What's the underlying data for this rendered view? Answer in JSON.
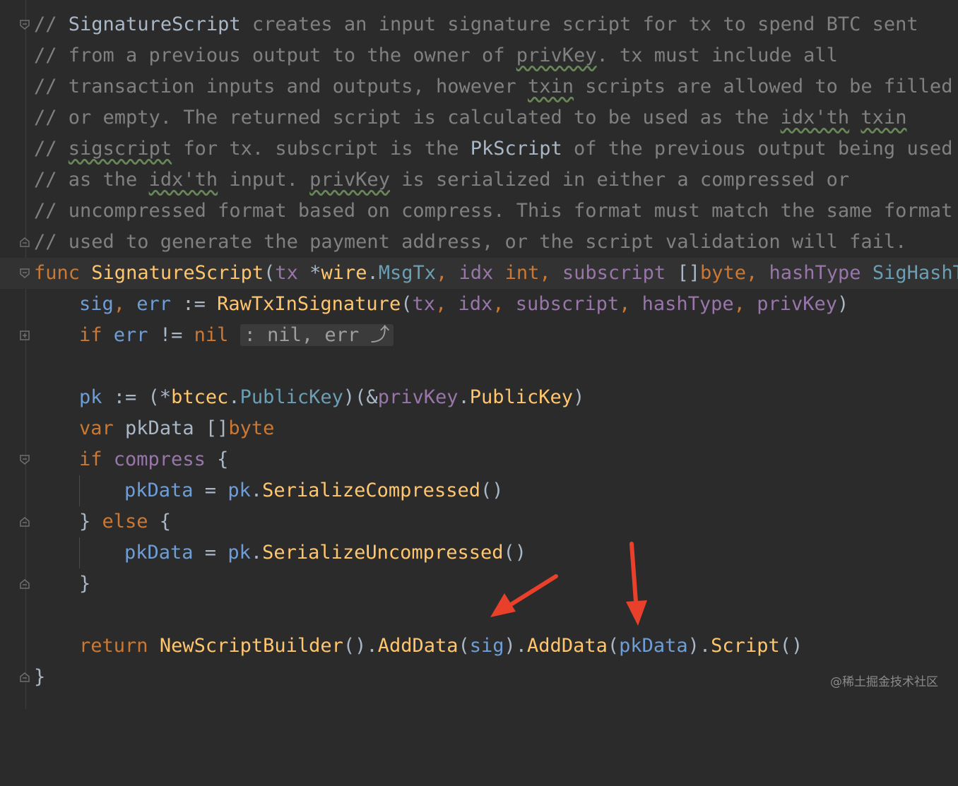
{
  "editor": {
    "comment_lines": [
      [
        "// ",
        "SignatureScript",
        " creates an input signature script for tx to spend BTC sent"
      ],
      [
        "// from a previous output to the owner of ",
        "privKey",
        ". tx must include all"
      ],
      [
        "// transaction inputs and outputs, however ",
        "txin",
        " scripts are allowed to be filled"
      ],
      [
        "// or empty. The returned script is calculated to be used as the ",
        "idx'th",
        " ",
        "txin"
      ],
      [
        "// ",
        "sigscript",
        " for tx. subscript is the ",
        "PkScript",
        " of the previous output being used"
      ],
      [
        "// as the ",
        "idx'th",
        " input. ",
        "privKey",
        " is serialized in either a compressed or"
      ],
      [
        "// uncompressed format based on compress. This format must match the same format"
      ],
      [
        "// used to generate the payment address, or the script validation will fail."
      ]
    ],
    "code": {
      "func_kw": "func",
      "func_name": "SignatureScript",
      "sig_tail": [
        "(",
        "tx",
        " *",
        "wire",
        ".",
        "MsgTx",
        ", ",
        "idx",
        " ",
        "int",
        ", ",
        "subscript",
        " []",
        "byte",
        ", ",
        "hashType",
        " ",
        "SigHashTy"
      ],
      "l10": [
        "sig",
        ", ",
        "err",
        " := ",
        "RawTxInSignature",
        "(",
        "tx",
        ", ",
        "idx",
        ", ",
        "subscript",
        ", ",
        "hashType",
        ", ",
        "privKey",
        ")"
      ],
      "l11": [
        "if",
        " ",
        "err",
        " != ",
        "nil",
        " ",
        ": nil, err ⤴"
      ],
      "l13": [
        "pk",
        " := (*",
        "btcec",
        ".",
        "PublicKey",
        ")(&",
        "privKey",
        ".",
        "PublicKey",
        ")"
      ],
      "l14": [
        "var",
        " ",
        "pkData",
        " []",
        "byte"
      ],
      "l15": [
        "if",
        " ",
        "compress",
        " {"
      ],
      "l16": [
        "pkData",
        " = ",
        "pk",
        ".",
        "SerializeCompressed",
        "()"
      ],
      "l17": [
        "} ",
        "else",
        " {"
      ],
      "l18": [
        "pkData",
        " = ",
        "pk",
        ".",
        "SerializeUncompressed",
        "()"
      ],
      "l19": [
        "}"
      ],
      "l21": [
        "return",
        " ",
        "NewScriptBuilder",
        "().",
        "AddData",
        "(",
        "sig",
        ").",
        "AddData",
        "(",
        "pkData",
        ").",
        "Script",
        "()"
      ],
      "l22": [
        "}"
      ]
    }
  },
  "watermark": "@稀土掘金技术社区",
  "colors": {
    "background": "#2b2b2b",
    "keyword": "#cc7832",
    "function": "#ffc66d",
    "param": "#9876aa",
    "comment": "#808080",
    "arrow": "#e8402a"
  }
}
